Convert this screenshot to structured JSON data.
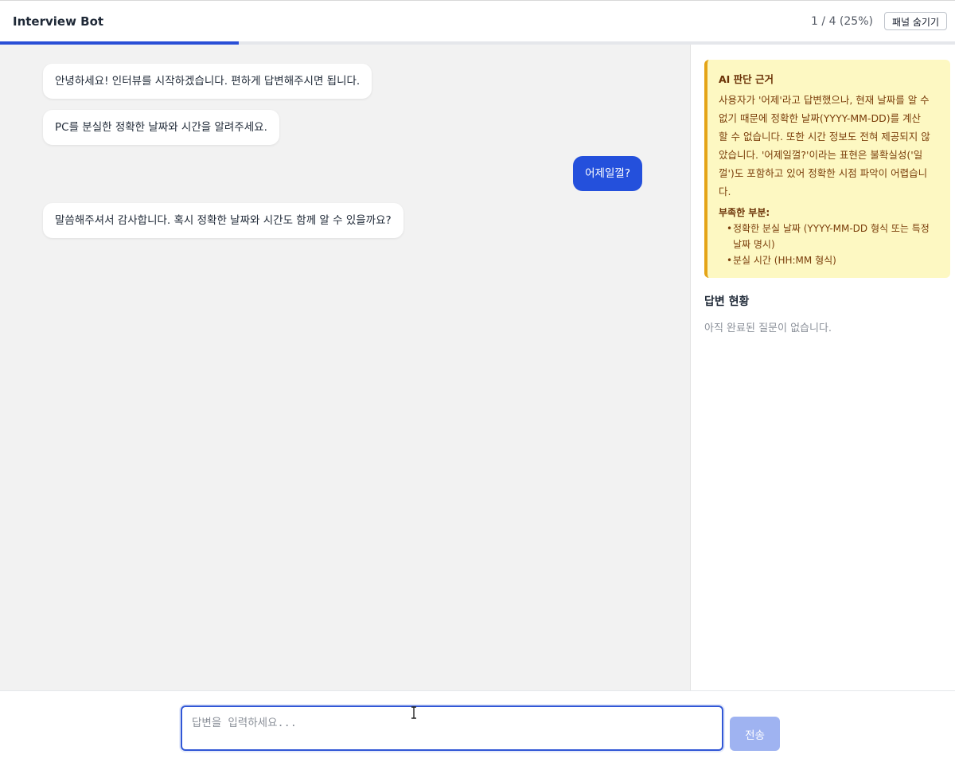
{
  "header": {
    "title": "Interview Bot",
    "progress_text": "1 / 4 (25%)",
    "progress_fraction": 0.25,
    "hide_panel_label": "패널 숨기기"
  },
  "chat": {
    "messages": [
      {
        "role": "bot",
        "text": "안녕하세요! 인터뷰를 시작하겠습니다. 편하게 답변해주시면 됩니다."
      },
      {
        "role": "bot",
        "text": "PC를 분실한 정확한 날짜와 시간을 알려주세요."
      },
      {
        "role": "user",
        "text": "어제일껄?"
      },
      {
        "role": "bot",
        "text": "말씀해주셔서 감사합니다. 혹시 정확한 날짜와 시간도 함께 알 수 있을까요?"
      }
    ]
  },
  "panel": {
    "ai_reason": {
      "title": "AI 판단 근거",
      "lines": [
        "사용자가 '어제'라고 답변했으나, 현재 날짜를 알 수",
        "없기 때문에 정확한 날짜(YYYY-MM-DD)를 계산",
        "할 수 없습니다. 또한 시간 정보도 전혀 제공되지 않",
        "았습니다. '어제일껄?'이라는 표현은 불확실성('일",
        "껄')도 포함하고 있어 정확한 시점 파악이 어렵습니",
        "다."
      ],
      "missing_title": "부족한 부분:",
      "missing_items": [
        "정확한 분실 날짜 (YYYY-MM-DD 형식 또는 특정",
        "분실 시간 (HH:MM 형식)"
      ],
      "missing_item_continuation": "날짜 명시)"
    },
    "status_title": "답변 현황",
    "status_empty": "아직 완료된 질문이 없습니다."
  },
  "input": {
    "placeholder": "답변을 입력하세요...",
    "value": "",
    "send_label": "전송"
  },
  "colors": {
    "accent": "#2450dc",
    "send_disabled": "#9fb3f1",
    "ai_box_bg": "#fdf8c2",
    "ai_box_border": "#e4a416",
    "chat_bg": "#f2f2f2"
  }
}
